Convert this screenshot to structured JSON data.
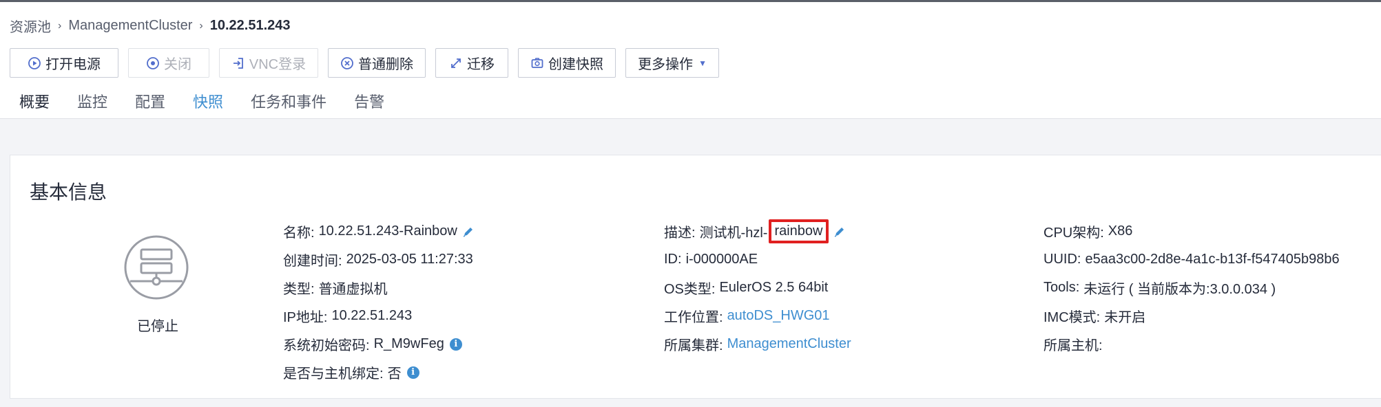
{
  "breadcrumb": {
    "items": [
      "资源池",
      "ManagementCluster"
    ],
    "current": "10.22.51.243",
    "separator": "›"
  },
  "toolbar": {
    "power_on": "打开电源",
    "shutdown": "关闭",
    "vnc_login": "VNC登录",
    "delete": "普通删除",
    "migrate": "迁移",
    "snapshot": "创建快照",
    "more": "更多操作"
  },
  "tabs": [
    "概要",
    "监控",
    "配置",
    "快照",
    "任务和事件",
    "告警"
  ],
  "card": {
    "title": "基本信息",
    "status": "已停止"
  },
  "info": {
    "col1": {
      "name_label": "名称:",
      "name_value": "10.22.51.243-Rainbow",
      "created_label": "创建时间:",
      "created_value": "2025-03-05 11:27:33",
      "type_label": "类型:",
      "type_value": "普通虚拟机",
      "ip_label": "IP地址:",
      "ip_value": "10.22.51.243",
      "password_label": "系统初始密码:",
      "password_value": "R_M9wFeg",
      "bind_label": "是否与主机绑定:",
      "bind_value": "否"
    },
    "col2": {
      "desc_label": "描述:",
      "desc_prefix": "测试机-hzl-",
      "desc_highlight": "rainbow",
      "id_label": "ID:",
      "id_value": "i-000000AE",
      "os_label": "OS类型:",
      "os_value": "EulerOS 2.5 64bit",
      "location_label": "工作位置:",
      "location_value": "autoDS_HWG01",
      "cluster_label": "所属集群:",
      "cluster_value": "ManagementCluster"
    },
    "col3": {
      "cpu_label": "CPU架构:",
      "cpu_value": "X86",
      "uuid_label": "UUID:",
      "uuid_value": "e5aa3c00-2d8e-4a1c-b13f-f547405b98b6",
      "tools_label": "Tools:",
      "tools_value": "未运行 ( 当前版本为:3.0.0.034 )",
      "imc_label": "IMC模式:",
      "imc_value": "未开启",
      "host_label": "所属主机:",
      "host_value": ""
    }
  },
  "colors": {
    "accent": "#526ecc",
    "link": "#3e8ed0",
    "highlight_border": "#e02020"
  }
}
